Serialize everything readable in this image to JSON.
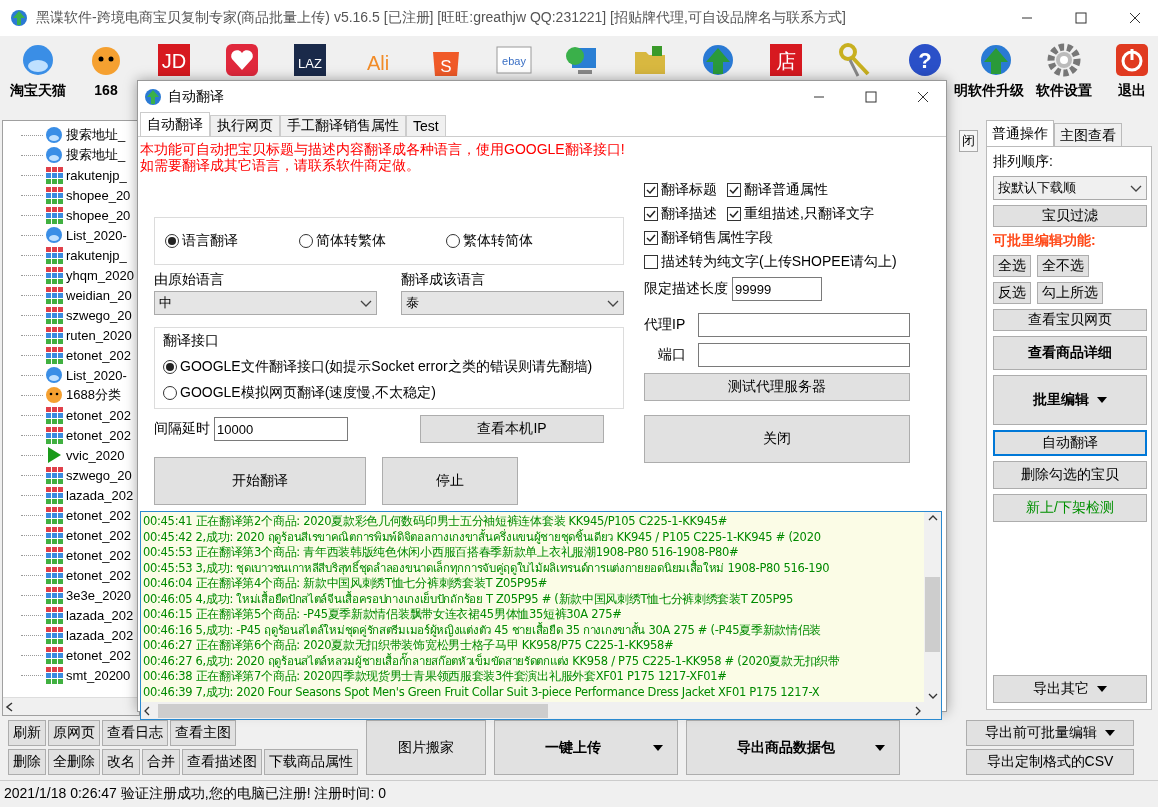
{
  "window": {
    "title": "黑谍软件-跨境电商宝贝复制专家(商品批量上传)  v5.16.5 [已注册] [旺旺:greathjw QQ:231221] [招贴牌代理,可自设品牌名与联系方式]"
  },
  "toolbar": [
    {
      "kind": "bird",
      "label": "淘宝天猫"
    },
    {
      "kind": "face",
      "label": "168"
    },
    {
      "kind": "redlogo",
      "glyph": "JD"
    },
    {
      "kind": "heart"
    },
    {
      "kind": "darklogo",
      "glyph": "LAZ"
    },
    {
      "kind": "ali",
      "glyph": "Ali"
    },
    {
      "kind": "bag",
      "glyph": "S"
    },
    {
      "kind": "ebay",
      "glyph": "ebay"
    },
    {
      "kind": "monitor"
    },
    {
      "kind": "folder"
    },
    {
      "kind": "arrow"
    },
    {
      "kind": "redlogo",
      "glyph": "店"
    },
    {
      "kind": "keys"
    },
    {
      "kind": "help",
      "glyph": "?",
      "label": "明"
    },
    {
      "kind": "arrow",
      "label": "软件升级"
    },
    {
      "kind": "gear",
      "label": "软件设置"
    },
    {
      "kind": "power",
      "label": "退出"
    }
  ],
  "tree": {
    "items": [
      {
        "kind": "bird",
        "label": "搜索地址_"
      },
      {
        "kind": "bird",
        "label": "搜索地址_"
      },
      {
        "kind": "grid",
        "label": "rakutenjp_"
      },
      {
        "kind": "grid",
        "label": "shopee_20"
      },
      {
        "kind": "grid",
        "label": "shopee_20"
      },
      {
        "kind": "bird",
        "label": "List_2020-"
      },
      {
        "kind": "grid",
        "label": "rakutenjp_"
      },
      {
        "kind": "grid",
        "label": "yhqm_2020"
      },
      {
        "kind": "grid",
        "label": "weidian_20"
      },
      {
        "kind": "grid",
        "label": "szwego_20"
      },
      {
        "kind": "grid",
        "label": "ruten_2020"
      },
      {
        "kind": "grid",
        "label": "etonet_202"
      },
      {
        "kind": "bird",
        "label": "List_2020-"
      },
      {
        "kind": "face",
        "label": "1688分类"
      },
      {
        "kind": "grid",
        "label": "etonet_202"
      },
      {
        "kind": "grid",
        "label": "etonet_202"
      },
      {
        "kind": "play",
        "label": "vvic_2020"
      },
      {
        "kind": "grid",
        "label": "szwego_20"
      },
      {
        "kind": "grid",
        "label": "lazada_202"
      },
      {
        "kind": "grid",
        "label": "etonet_202"
      },
      {
        "kind": "grid",
        "label": "etonet_202"
      },
      {
        "kind": "grid",
        "label": "etonet_202"
      },
      {
        "kind": "grid",
        "label": "etonet_202"
      },
      {
        "kind": "grid",
        "label": "3e3e_2020"
      },
      {
        "kind": "grid",
        "label": "lazada_202"
      },
      {
        "kind": "grid",
        "label": "lazada_202"
      },
      {
        "kind": "grid",
        "label": "etonet_202"
      },
      {
        "kind": "grid",
        "label": "smt_20200"
      }
    ]
  },
  "middle_stub": "闭",
  "right_panel": {
    "tabs": [
      {
        "label": "普通操作",
        "selected": true
      },
      {
        "label": "主图查看",
        "selected": false
      }
    ],
    "sort_label": "排列顺序:",
    "sort_value": "按默认下载顺",
    "rows": [
      {
        "kind": "button",
        "labels": [
          "宝贝过滤"
        ]
      },
      {
        "kind": "heading",
        "labels": [
          "可批里编辑功能:"
        ]
      },
      {
        "kind": "pair",
        "labels": [
          "全选",
          "全不选"
        ]
      },
      {
        "kind": "pair",
        "labels": [
          "反选",
          "勾上所选"
        ]
      },
      {
        "kind": "button",
        "labels": [
          "查看宝贝网页"
        ]
      },
      {
        "kind": "big",
        "labels": [
          "查看商品详细"
        ]
      },
      {
        "kind": "bigmenu",
        "labels": [
          "批里编辑"
        ]
      },
      {
        "kind": "focused",
        "labels": [
          "自动翻译"
        ]
      },
      {
        "kind": "tall",
        "labels": [
          "删除勾选的宝贝"
        ]
      },
      {
        "kind": "green",
        "labels": [
          "新上/下架检测"
        ]
      },
      {
        "kind": "spacer",
        "labels": []
      },
      {
        "kind": "menu",
        "labels": [
          "导出其它"
        ]
      }
    ]
  },
  "bottom": {
    "small_rows": [
      [
        "刷新",
        "原网页",
        "查看日志",
        "查看主图"
      ],
      [
        "删除",
        "全删除",
        "改名",
        "合并",
        "查看描述图",
        "下载商品属性"
      ]
    ],
    "big_buttons": [
      {
        "label": "图片搬家",
        "bold": false,
        "menu": false
      },
      {
        "label": "一键上传",
        "bold": true,
        "menu": true
      },
      {
        "label": "导出商品数据包",
        "bold": true,
        "menu": true
      }
    ],
    "right_buttons": [
      {
        "label": "导出前可批量编辑",
        "menu": true
      },
      {
        "label": "导出定制格式的CSV",
        "menu": false
      }
    ]
  },
  "status_bar": "2021/1/18 0:26:47 验证注册成功,您的电脑已注册!  注册时间: 0",
  "dialog": {
    "title": "自动翻译",
    "tabs": [
      {
        "label": "自动翻译",
        "selected": true
      },
      {
        "label": "执行网页",
        "selected": false
      },
      {
        "label": "手工翻译销售属性",
        "selected": false
      },
      {
        "label": "Test",
        "selected": false
      }
    ],
    "notice": [
      "本功能可自动把宝贝标题与描述内容翻译成各种语言，使用GOOGLE翻译接口!",
      "如需要翻译成其它语言，请联系软件商定做。"
    ],
    "modes": [
      {
        "label": "语言翻译",
        "selected": true
      },
      {
        "label": "简体转繁体",
        "selected": false
      },
      {
        "label": "繁体转简体",
        "selected": false
      }
    ],
    "source_label": "由原始语言",
    "source_value": "中",
    "target_label": "翻译成该语言",
    "target_value": "泰",
    "api_group": "翻译接口",
    "apis": [
      {
        "label": "GOOGLE文件翻译接口(如提示Socket error之类的错误则请先翻墙)",
        "selected": true
      },
      {
        "label": "GOOGLE模拟网页翻译(速度慢,不太稳定)",
        "selected": false
      }
    ],
    "delay_label": "间隔延时",
    "delay_value": "10000",
    "check_ip": "查看本机IP",
    "start": "开始翻译",
    "stop": "停止",
    "options": [
      {
        "label": "翻译标题",
        "checked": true
      },
      {
        "label": "翻译普通属性",
        "checked": true
      },
      {
        "label": "翻译描述",
        "checked": true
      },
      {
        "label": "重组描述,只翻译文字",
        "checked": true
      },
      {
        "label": "翻译销售属性字段",
        "checked": true
      },
      {
        "label": "描述转为纯文字(上传SHOPEE请勾上)",
        "checked": false
      }
    ],
    "limit_label": "限定描述长度",
    "limit_value": "99999",
    "proxy_label": "代理IP",
    "port_label": "端口",
    "test_proxy": "测试代理服务器",
    "close": "关闭",
    "log": [
      "00:45:41 正在翻译第2个商品: 2020夏款彩色几何数码印男士五分袖短裤连体套装 KK945/P105 C225-1-KK945#",
      "00:45:42 2,成功: 2020 ฤดูร้อนสีเรขาคณิตการพิมพ์ดิจิตอลกางเกงขาสั้นครึ่งแขนผู้ชายชุดชิ้นเดียว KK945 / P105 C225-1-KK945 # (2020",
      "00:45:53 正在翻译第3个商品: 青年西装韩版纯色休闲小西服百搭春季新款单上衣礼服潮1908-P80 516-1908-P80#",
      "00:45:53 3,成功: ชุดเบาวชนเกาหลีสีบริสุทธิ์ชุดลำลองขนาดเล็กทุกการจับคู่ฤดูใบไม้ผลิเทรนด์การแต่งกายยอดนิยมเสื้อใหม่ 1908-P80 516-190",
      "00:46:04 正在翻译第4个商品: 新款中国风刺绣T恤七分裤刺绣套装T Z05P95#",
      "00:46:05 4,成功: ใหม่เสื้อยืดปักสไตล์จีนเสื้อครอปกางเกงเย็บปักถักร้อย T Z05P95 # (新款中国风刺绣T恤七分裤刺绣套装T Z05P95",
      "00:46:15 正在翻译第5个商品: -P45夏季新款情侣装飘带女连衣裙45男体恤35短裤30A 275#",
      "00:46:16 5,成功: -P45 ฤดูร้อนสไตล์ใหม่ชุดคู่รักสตรีมเมอร์ผู้หญิงแต่งตัว 45 ชายเสื้อยืด 35 กางเกงขาสั้น 30A 275 # (-P45夏季新款情侣装",
      "00:46:27 正在翻译第6个商品: 2020夏款无扣织带装饰宽松男士格子马甲 KK958/P75 C225-1-KK958#",
      "00:46:27 6,成功: 2020 ฤดูร้อนสไตล์หลวมผู้ชายเสื้อกั๊กลายสก๊อตหัวเข็มขัดสายรัดตกแต่ง KK958 / P75 C225-1-KK958 # (2020夏款无扣织带",
      "00:46:38 正在翻译第7个商品: 2020四季款现货男士青果领西服套装3件套演出礼服外套XF01 P175 1217-XF01#",
      "00:46:39 7,成功: 2020 Four Seasons Spot Men's Green Fruit Collar Suit 3-piece Performance Dress Jacket XF01 P175 1217-X"
    ]
  }
}
